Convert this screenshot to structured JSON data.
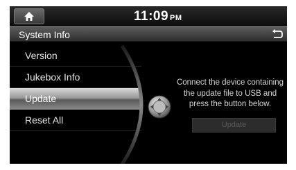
{
  "status_bar": {
    "time": "11:09",
    "ampm": "PM",
    "home_icon": "home-icon"
  },
  "title_bar": {
    "title": "System Info",
    "back_icon": "back-arrow-icon"
  },
  "menu": {
    "items": [
      {
        "label": "Version"
      },
      {
        "label": "Jukebox Info"
      },
      {
        "label": "Update",
        "selected": true
      },
      {
        "label": "Reset All"
      }
    ]
  },
  "update_panel": {
    "message_lines": [
      "Connect the device containing",
      "the update file to USB and",
      "press the button below."
    ],
    "button_label": "Update",
    "button_enabled": false
  },
  "colors": {
    "background": "#000000",
    "selected_item": "#9a9a9a",
    "disabled_button_text": "#5a5a5a"
  }
}
